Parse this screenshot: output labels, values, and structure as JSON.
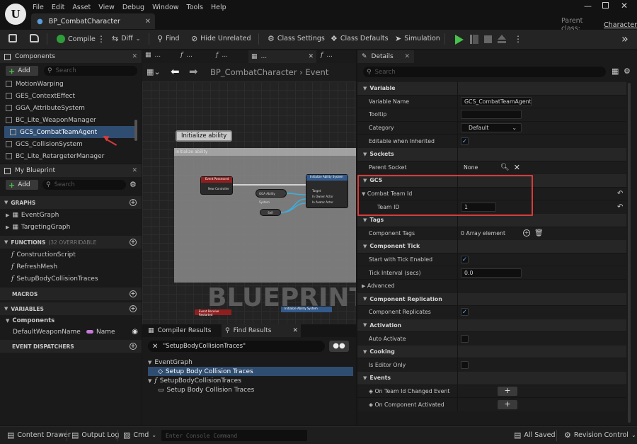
{
  "title_bar": {
    "menus": [
      "File",
      "Edit",
      "Asset",
      "View",
      "Debug",
      "Window",
      "Tools",
      "Help"
    ],
    "tab": "BP_CombatCharacter",
    "parent_class_label": "Parent class:",
    "parent_class_value": "Character"
  },
  "toolbar": {
    "compile": "Compile",
    "diff": "Diff",
    "find": "Find",
    "hide_unrelated": "Hide Unrelated",
    "class_settings": "Class Settings",
    "class_defaults": "Class Defaults",
    "simulation": "Simulation"
  },
  "components": {
    "title": "Components",
    "add": "Add",
    "search_placeholder": "Search",
    "items": [
      "MotionWarping",
      "GES_ContextEffect",
      "GGA_AttributeSystem",
      "BC_Lite_WeaponManager",
      "GCS_CombatTeamAgent",
      "GCS_CollisionSystem",
      "BC_Lite_RetargeterManager"
    ]
  },
  "my_blueprint": {
    "title": "My Blueprint",
    "add": "Add",
    "search_placeholder": "Search",
    "graphs": "GRAPHS",
    "graph_items": [
      "EventGraph",
      "TargetingGraph"
    ],
    "functions": "FUNCTIONS",
    "functions_count": "(32 OVERRIDABLE",
    "function_items": [
      "ConstructionScript",
      "RefreshMesh",
      "SetupBodyCollisionTraces"
    ],
    "macros": "MACROS",
    "variables": "VARIABLES",
    "var_category": "Components",
    "var_item": "DefaultWeaponName",
    "var_type": "Name",
    "event_dispatchers": "EVENT DISPATCHERS"
  },
  "graph": {
    "tabs": [
      "...",
      "...",
      "...",
      "...",
      "..."
    ],
    "breadcrumb": "BP_CombatCharacter",
    "breadcrumb_sub": "Event",
    "comment_title": "Initialize ability",
    "comment_label": "Initialize ability",
    "watermark": "BLUEPRINT",
    "node_event": "Event Possessed",
    "node_event_pin": "New Controller",
    "node_get": "GGA Ability System",
    "node_call": "Initialize Ability System",
    "pin_target": "Target",
    "pin_owner": "In Owner Actor",
    "pin_avatar": "In Avatar Actor",
    "node_self": "Self",
    "node_bottom_left": "Event Receive Restarted",
    "node_bottom_right": "Initialize Ability System"
  },
  "find_results": {
    "tab_compiler": "Compiler Results",
    "tab_find": "Find Results",
    "query": "\"SetupBodyCollisionTraces\"",
    "results": [
      {
        "text": "EventGraph",
        "level": 0
      },
      {
        "text": "Setup Body Collision Traces",
        "level": 1
      },
      {
        "text": "SetupBodyCollisionTraces",
        "level": 0
      },
      {
        "text": "Setup Body Collision Traces",
        "level": 1
      }
    ]
  },
  "details": {
    "title": "Details",
    "search_placeholder": "Search",
    "variable": "Variable",
    "variable_name_label": "Variable Name",
    "variable_name": "GCS_CombatTeamAgent",
    "tooltip_label": "Tooltip",
    "category_label": "Category",
    "category_value": "Default",
    "editable_label": "Editable when Inherited",
    "sockets": "Sockets",
    "parent_socket_label": "Parent Socket",
    "parent_socket_value": "None",
    "gcs": "GCS",
    "combat_team_id": "Combat Team Id",
    "team_id_label": "Team ID",
    "team_id_value": "1",
    "tags": "Tags",
    "component_tags_label": "Component Tags",
    "component_tags_value": "0 Array element",
    "component_tick": "Component Tick",
    "start_tick_label": "Start with Tick Enabled",
    "tick_interval_label": "Tick Interval (secs)",
    "tick_interval_value": "0.0",
    "advanced": "Advanced",
    "component_replication": "Component Replication",
    "replicates_label": "Component Replicates",
    "activation": "Activation",
    "auto_activate_label": "Auto Activate",
    "cooking": "Cooking",
    "editor_only_label": "Is Editor Only",
    "events": "Events",
    "event1": "On Team Id Changed Event",
    "event2": "On Component Activated"
  },
  "status": {
    "content_drawer": "Content Drawer",
    "output_log": "Output Log",
    "cmd": "Cmd",
    "console_placeholder": "Enter Console Command",
    "all_saved": "All Saved",
    "revision_control": "Revision Control"
  },
  "colors": {
    "highlight_box": "#d93a3a",
    "accent_green": "#47c24b",
    "selection": "#2f4d70",
    "check": "#59a7ff"
  }
}
